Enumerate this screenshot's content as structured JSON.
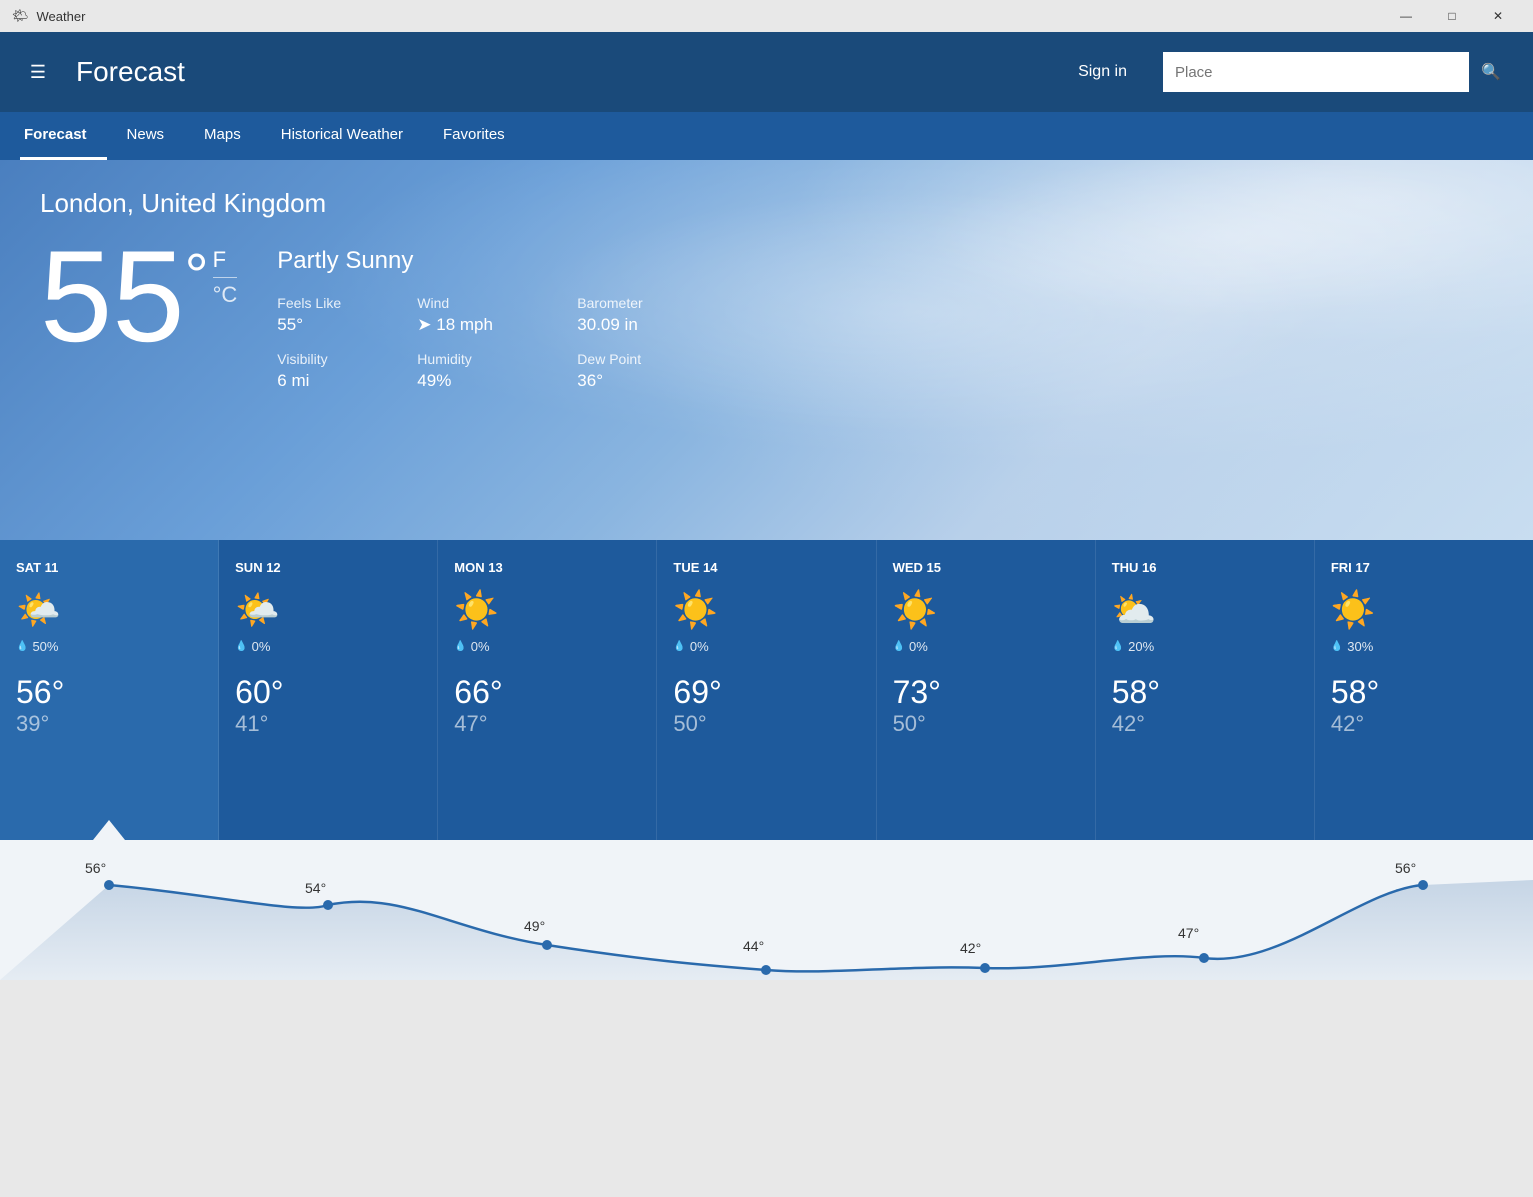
{
  "titlebar": {
    "app_name": "Weather",
    "minimize": "—",
    "maximize": "□",
    "close": "✕"
  },
  "header": {
    "hamburger": "☰",
    "title": "Forecast",
    "sign_in": "Sign in",
    "search_placeholder": "Place"
  },
  "nav": {
    "items": [
      {
        "label": "Forecast",
        "active": true
      },
      {
        "label": "News",
        "active": false
      },
      {
        "label": "Maps",
        "active": false
      },
      {
        "label": "Historical Weather",
        "active": false
      },
      {
        "label": "Favorites",
        "active": false
      }
    ]
  },
  "hero": {
    "location": "London, United Kingdom",
    "temperature": "55",
    "degree_symbol": "°",
    "scale_f": "F",
    "scale_c": "°C",
    "condition": "Partly Sunny",
    "details": {
      "feels_like_label": "Feels Like",
      "feels_like_value": "55°",
      "wind_label": "Wind",
      "wind_value": "➤ 18 mph",
      "barometer_label": "Barometer",
      "barometer_value": "30.09 in",
      "visibility_label": "Visibility",
      "visibility_value": "6 mi",
      "humidity_label": "Humidity",
      "humidity_value": "49%",
      "dew_point_label": "Dew Point",
      "dew_point_value": "36°"
    }
  },
  "forecast": {
    "days": [
      {
        "name": "SAT 11",
        "icon": "🌤️",
        "precip": "50%",
        "high": "56°",
        "low": "39°",
        "active": true
      },
      {
        "name": "SUN 12",
        "icon": "🌤️",
        "precip": "0%",
        "high": "60°",
        "low": "41°",
        "active": false
      },
      {
        "name": "MON 13",
        "icon": "☀️",
        "precip": "0%",
        "high": "66°",
        "low": "47°",
        "active": false
      },
      {
        "name": "TUE 14",
        "icon": "☀️",
        "precip": "0%",
        "high": "69°",
        "low": "50°",
        "active": false
      },
      {
        "name": "WED 15",
        "icon": "☀️",
        "precip": "0%",
        "high": "73°",
        "low": "50°",
        "active": false
      },
      {
        "name": "THU 16",
        "icon": "⛅",
        "precip": "20%",
        "high": "58°",
        "low": "42°",
        "active": false
      },
      {
        "name": "FRI 17",
        "icon": "☀️",
        "precip": "30%",
        "high": "58°",
        "low": "42°",
        "active": false
      }
    ]
  },
  "chart": {
    "high_labels": [
      "56°",
      "54°",
      "49°",
      "44°",
      "42°",
      "47°",
      "56°"
    ],
    "low_labels": [
      "",
      "",
      "",
      "",
      "",
      "",
      ""
    ],
    "colors": {
      "line": "#1e5a9c",
      "fill": "rgba(30,90,156,0.15)"
    }
  }
}
